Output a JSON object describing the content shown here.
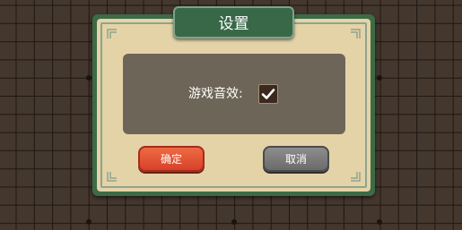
{
  "dialog": {
    "title": "设置",
    "sound_label": "游戏音效:",
    "sound_enabled": true,
    "confirm_label": "确定",
    "cancel_label": "取消"
  },
  "colors": {
    "board": "#44372d",
    "grid_line": "#1f1813",
    "dialog_border": "#3d6b46",
    "dialog_fill": "#e5d3a8",
    "panel": "#6d6557",
    "confirm": "#e35a36",
    "cancel": "#7d7d7d"
  }
}
